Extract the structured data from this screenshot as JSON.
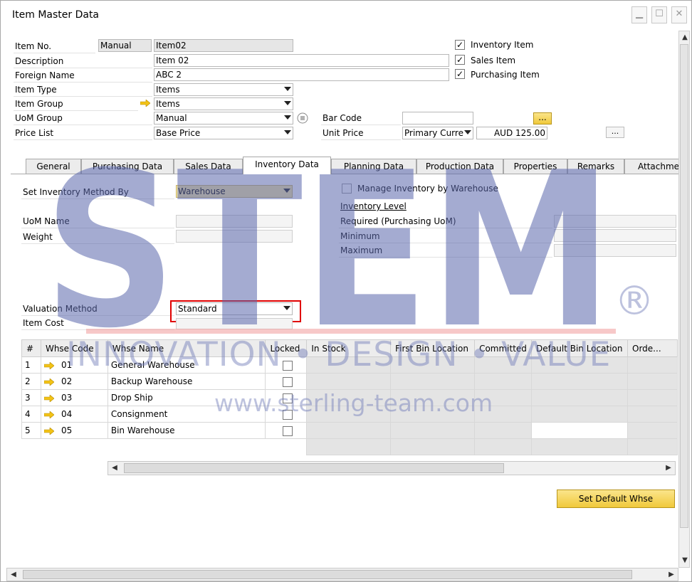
{
  "window": {
    "title": "Item Master Data"
  },
  "header": {
    "item_no_label": "Item No.",
    "item_no_series": "Manual",
    "item_no_value": "Item02",
    "description_label": "Description",
    "description_value": "Item 02",
    "foreign_name_label": "Foreign Name",
    "foreign_name_value": "ABC 2",
    "item_type_label": "Item Type",
    "item_type_value": "Items",
    "item_group_label": "Item Group",
    "item_group_value": "Items",
    "uom_group_label": "UoM Group",
    "uom_group_value": "Manual",
    "price_list_label": "Price List",
    "price_list_value": "Base Price",
    "bar_code_label": "Bar Code",
    "bar_code_value": "",
    "unit_price_label": "Unit Price",
    "unit_price_currency": "Primary Curre",
    "unit_price_value": "AUD 125.00",
    "inventory_item_label": "Inventory Item",
    "sales_item_label": "Sales Item",
    "purchasing_item_label": "Purchasing Item",
    "dots_label": "..."
  },
  "tabs": [
    "General",
    "Purchasing Data",
    "Sales Data",
    "Inventory Data",
    "Planning Data",
    "Production Data",
    "Properties",
    "Remarks",
    "Attachme"
  ],
  "inventory": {
    "set_method_label": "Set Inventory Method By",
    "set_method_value": "Warehouse",
    "manage_by_wh_label": "Manage Inventory by Warehouse",
    "inventory_level_label": "Inventory Level",
    "required_label": "Required (Purchasing UoM)",
    "minimum_label": "Minimum",
    "maximum_label": "Maximum",
    "uom_name_label": "UoM Name",
    "weight_label": "Weight",
    "valuation_method_label": "Valuation Method",
    "valuation_method_value": "Standard",
    "item_cost_label": "Item Cost"
  },
  "grid": {
    "columns": [
      "#",
      "Whse Code",
      "Whse Name",
      "Locked",
      "In Stock",
      "First Bin Location",
      "Committed",
      "Default Bin Location",
      "Orde..."
    ],
    "rows": [
      {
        "num": "1",
        "code": "01",
        "name": "General Warehouse"
      },
      {
        "num": "2",
        "code": "02",
        "name": "Backup Warehouse"
      },
      {
        "num": "3",
        "code": "03",
        "name": "Drop Ship"
      },
      {
        "num": "4",
        "code": "04",
        "name": "Consignment"
      },
      {
        "num": "5",
        "code": "05",
        "name": "Bin Warehouse"
      }
    ]
  },
  "buttons": {
    "set_default_whse": "Set Default Whse"
  },
  "watermark": {
    "logo": "STEM",
    "registered": "®",
    "tagline": "INNOVATION • DESIGN • VALUE",
    "url": "www.sterling-team.com"
  },
  "colors": {
    "accent_yellow": "#f0c93b",
    "highlight_red": "#e00000",
    "watermark_blue": "#6e7ab8"
  }
}
